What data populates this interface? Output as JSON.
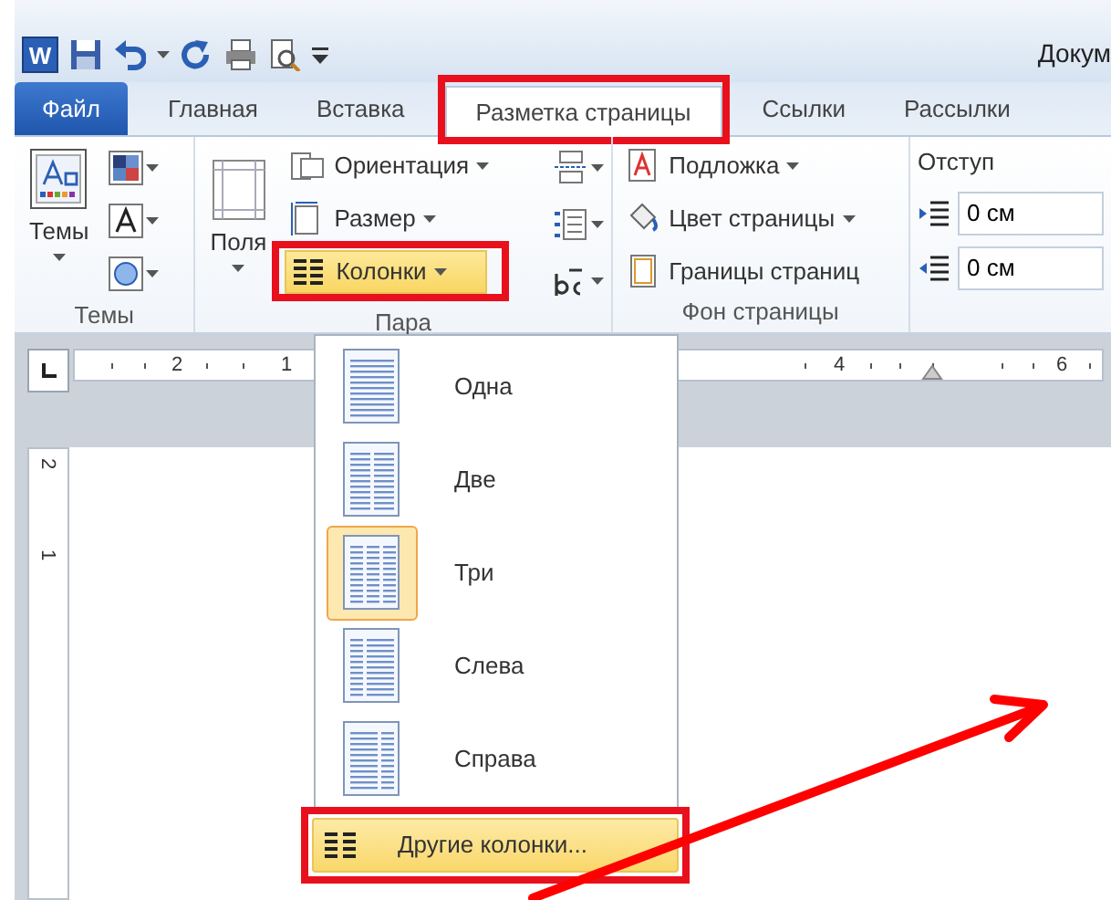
{
  "app_logo": "W",
  "window_title": "Докум",
  "tabs": [
    {
      "label": "Файл",
      "kind": "file",
      "selected": false,
      "annotated": false
    },
    {
      "label": "Главная",
      "kind": "tab",
      "selected": false,
      "annotated": false
    },
    {
      "label": "Вставка",
      "kind": "tab",
      "selected": false,
      "annotated": false
    },
    {
      "label": "Разметка страницы",
      "kind": "tab",
      "selected": true,
      "annotated": true
    },
    {
      "label": "Ссылки",
      "kind": "tab",
      "selected": false,
      "annotated": false
    },
    {
      "label": "Рассылки",
      "kind": "tab",
      "selected": false,
      "annotated": false
    }
  ],
  "ribbon": [
    {
      "kind": "themes",
      "label": "Темы",
      "big_button": "Темы"
    },
    {
      "kind": "page_setup",
      "label": "Пара",
      "big_button": "Поля",
      "commands": [
        {
          "label": "Ориентация",
          "dropdown": true,
          "hover": false,
          "annotated": false
        },
        {
          "label": "Размер",
          "dropdown": true,
          "hover": false,
          "annotated": false
        },
        {
          "label": "Колонки",
          "dropdown": true,
          "hover": true,
          "annotated": true
        }
      ]
    },
    {
      "kind": "background",
      "label": "Фон страницы",
      "commands": [
        {
          "label": "Подложка",
          "dropdown": true,
          "hover": false,
          "annotated": false
        },
        {
          "label": "Цвет страницы",
          "dropdown": true,
          "hover": false,
          "annotated": false
        },
        {
          "label": "Границы страниц",
          "dropdown": false,
          "hover": false,
          "annotated": false
        }
      ]
    },
    {
      "kind": "indent",
      "header": "Отступ",
      "fields": [
        {
          "value": "0 см"
        },
        {
          "value": "0 см"
        }
      ]
    }
  ],
  "ruler": {
    "numbers": [
      "2",
      "1",
      "4",
      "6"
    ]
  },
  "vertical_ruler": {
    "numbers": [
      "2",
      "1"
    ]
  },
  "columns_menu": {
    "items": [
      {
        "label": "Одна",
        "kind": "one",
        "selected": false
      },
      {
        "label": "Две",
        "kind": "two",
        "selected": false
      },
      {
        "label": "Три",
        "kind": "three",
        "selected": true
      },
      {
        "label": "Слева",
        "kind": "left",
        "selected": false
      },
      {
        "label": "Справа",
        "kind": "right",
        "selected": false
      }
    ],
    "more": {
      "label": "Другие колонки...",
      "hover": true,
      "annotated": true
    }
  }
}
